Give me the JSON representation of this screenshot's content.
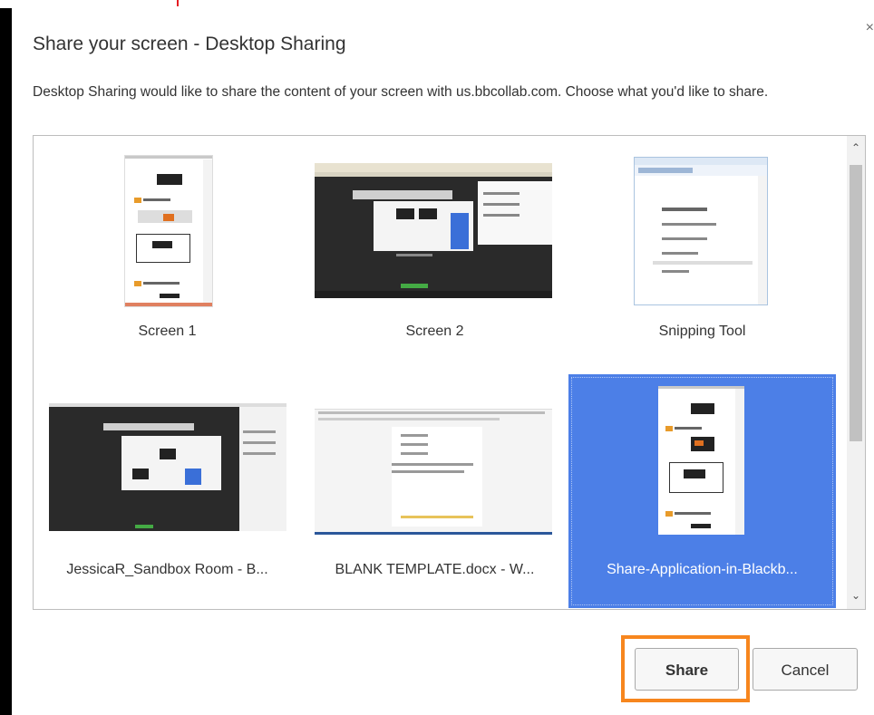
{
  "dialog": {
    "title": "Share your screen - Desktop Sharing",
    "description": "Desktop Sharing would like to share the content of your screen with us.bbcollab.com. Choose what you'd like to share.",
    "close_glyph": "×"
  },
  "sources": [
    {
      "label": "Screen 1",
      "selected": false
    },
    {
      "label": "Screen 2",
      "selected": false
    },
    {
      "label": "Snipping Tool",
      "selected": false
    },
    {
      "label": "JessicaR_Sandbox Room - B...",
      "selected": false
    },
    {
      "label": "BLANK TEMPLATE.docx - W...",
      "selected": false
    },
    {
      "label": "Share-Application-in-Blackb...",
      "selected": true
    }
  ],
  "scrollbar": {
    "up_glyph": "⌃",
    "down_glyph": "⌄"
  },
  "buttons": {
    "share_label": "Share",
    "cancel_label": "Cancel"
  },
  "colors": {
    "selection": "#4c7fe7",
    "highlight": "#f7861e",
    "accent_red": "#e51c23"
  }
}
